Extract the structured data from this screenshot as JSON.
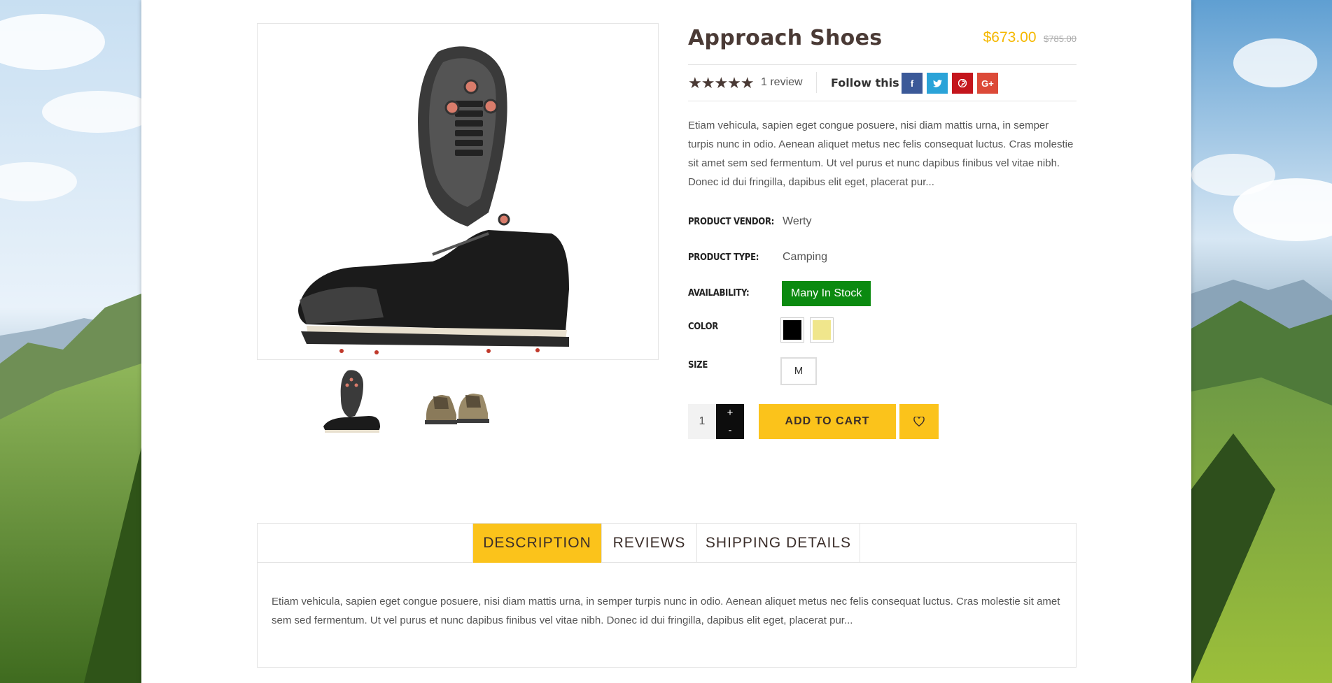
{
  "product": {
    "title": "Approach Shoes",
    "price": "$673.00",
    "compare_price": "$785.00",
    "rating_stars": "★★★★★",
    "rating": 5,
    "review_count_label": "1 review",
    "follow_label": "Follow this",
    "social": {
      "facebook": "f",
      "twitter": "t",
      "pinterest": "p",
      "google_plus": "G+"
    },
    "short_description": "Etiam vehicula, sapien eget congue posuere, nisi diam mattis urna, in semper turpis nunc in odio. Aenean aliquet metus nec felis consequat luctus. Cras molestie sit amet sem sed fermentum. Ut vel purus et nunc dapibus finibus vel vitae nibh. Donec id dui fringilla, dapibus elit eget, placerat pur...",
    "vendor_label": "PRODUCT VENDOR:",
    "vendor": "Werty",
    "type_label": "PRODUCT TYPE:",
    "type": "Camping",
    "availability_label": "AVAILABILITY:",
    "availability": "Many In Stock",
    "color_label": "COLOR",
    "colors": [
      "#000000",
      "#f0e68c"
    ],
    "size_label": "SIZE",
    "size": "M",
    "quantity": "1",
    "qty_plus": "+",
    "qty_minus": "-",
    "add_to_cart": "ADD TO CART"
  },
  "tabs": {
    "description": "DESCRIPTION",
    "reviews": "REVIEWS",
    "shipping": "SHIPPING DETAILS",
    "content": "Etiam vehicula, sapien eget congue posuere, nisi diam mattis urna, in semper turpis nunc in odio. Aenean aliquet metus nec felis consequat luctus. Cras molestie sit amet sem sed fermentum. Ut vel purus et nunc dapibus finibus vel vitae nibh. Donec id dui fringilla, dapibus elit eget, placerat pur..."
  },
  "colors": {
    "accent": "#fbc31b",
    "price": "#f5b800",
    "in_stock": "#0b8a10",
    "title": "#4a3a35"
  }
}
